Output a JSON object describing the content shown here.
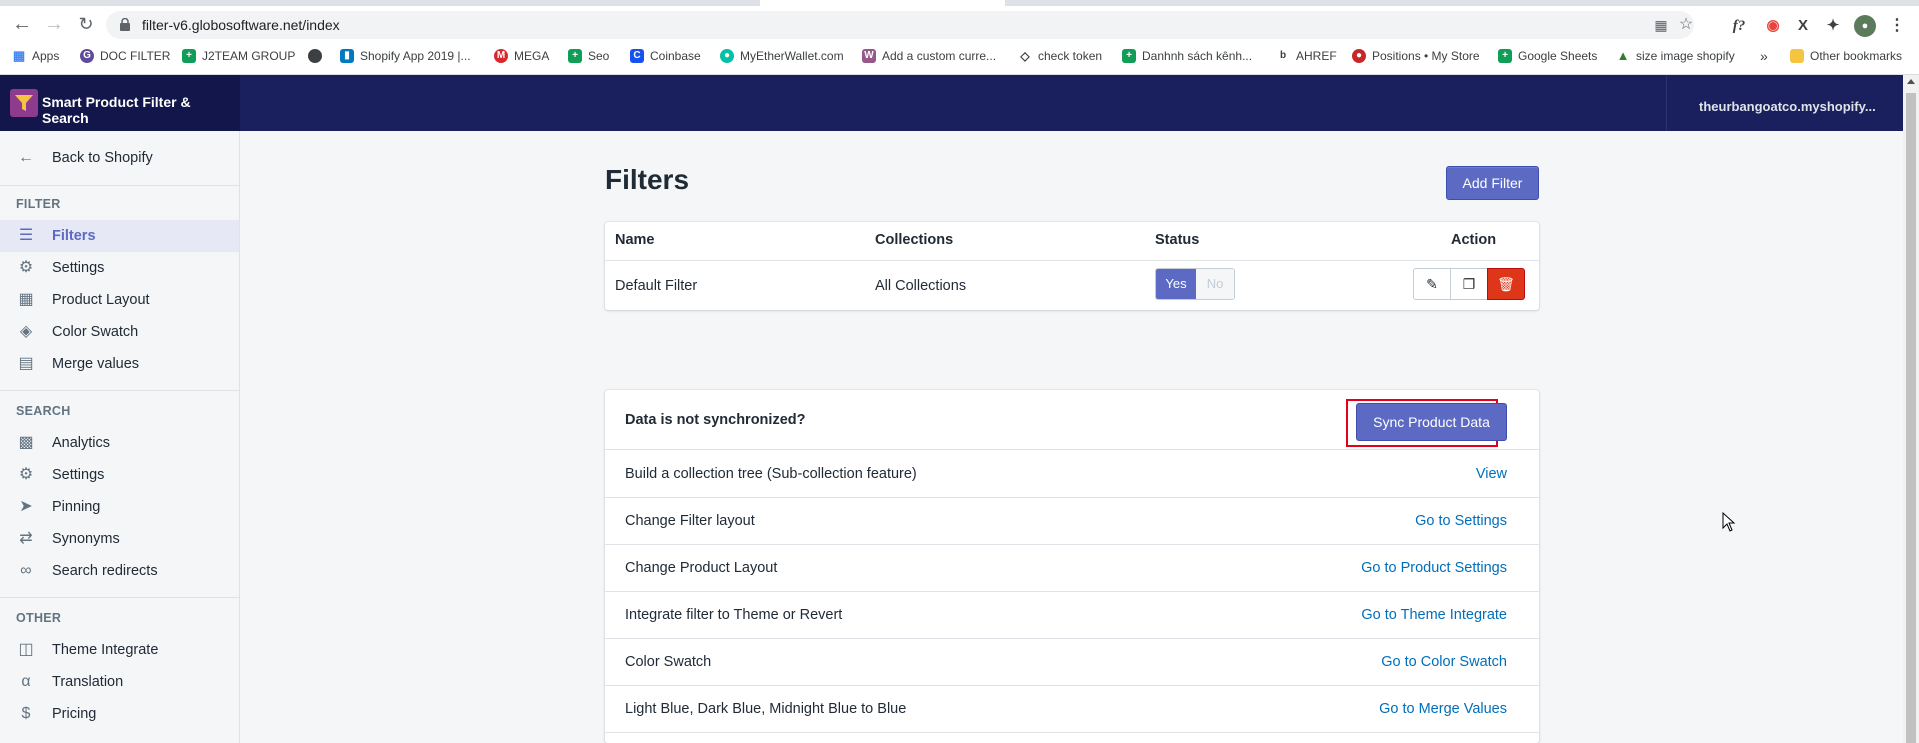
{
  "browser": {
    "url": "filter-v6.globosoftware.net/index",
    "bookmarks": [
      {
        "label": "Apps",
        "icon": "apps-grid-icon",
        "color": "#4285f4"
      },
      {
        "label": "DOC FILTER",
        "icon": "g-circle-icon",
        "color": "#5f4b9b"
      },
      {
        "label": "J2TEAM GROUP",
        "icon": "sheets-icon",
        "color": "#0f9d58"
      },
      {
        "label": "",
        "icon": "globe-icon",
        "color": "#3c4043"
      },
      {
        "label": "Shopify App 2019 |...",
        "icon": "trello-icon",
        "color": "#0079bf"
      },
      {
        "label": "MEGA",
        "icon": "mega-icon",
        "color": "#d9272e"
      },
      {
        "label": "Seo",
        "icon": "sheets-icon",
        "color": "#0f9d58"
      },
      {
        "label": "Coinbase",
        "icon": "coinbase-icon",
        "color": "#1652f0"
      },
      {
        "label": "MyEtherWallet.com",
        "icon": "mew-icon",
        "color": "#05c0a5"
      },
      {
        "label": "Add a custom curre...",
        "icon": "woo-icon",
        "color": "#96588a"
      },
      {
        "label": "check token",
        "icon": "ethereum-icon",
        "color": "#3c4043"
      },
      {
        "label": "Danhnh sách kênh...",
        "icon": "sheets-icon",
        "color": "#0f9d58"
      },
      {
        "label": "AHREF",
        "icon": "ahrefs-icon",
        "color": "#3c4043"
      },
      {
        "label": "Positions • My Store",
        "icon": "positions-icon",
        "color": "#c62828"
      },
      {
        "label": "Google Sheets",
        "icon": "sheets-icon",
        "color": "#0f9d58"
      },
      {
        "label": "size image shopify",
        "icon": "shopify-icon",
        "color": "#2e7d32"
      }
    ],
    "overflow": "»",
    "other_bookmarks": "Other bookmarks"
  },
  "app": {
    "title": "Smart Product Filter & Search",
    "store": "theurbangoatco.myshopify..."
  },
  "sidebar": {
    "back": "Back to Shopify",
    "sections": {
      "filter": "FILTER",
      "search": "SEARCH",
      "other": "OTHER"
    },
    "filter_items": [
      "Filters",
      "Settings",
      "Product Layout",
      "Color Swatch",
      "Merge values"
    ],
    "search_items": [
      "Analytics",
      "Settings",
      "Pinning",
      "Synonyms",
      "Search redirects"
    ],
    "other_items": [
      "Theme Integrate",
      "Translation",
      "Pricing"
    ]
  },
  "main": {
    "title": "Filters",
    "add_filter": "Add Filter",
    "table": {
      "headers": [
        "Name",
        "Collections",
        "Status",
        "Action"
      ],
      "rows": [
        {
          "name": "Default Filter",
          "collections": "All Collections",
          "status_yes": "Yes",
          "status_no": "No"
        }
      ]
    },
    "sync": {
      "question": "Data is not synchronized?",
      "button": "Sync Product Data"
    },
    "links": [
      {
        "label": "Build a collection tree (Sub-collection feature)",
        "link": "View"
      },
      {
        "label": "Change Filter layout",
        "link": "Go to Settings"
      },
      {
        "label": "Change Product Layout",
        "link": "Go to Product Settings"
      },
      {
        "label": "Integrate filter to Theme or Revert",
        "link": "Go to Theme Integrate"
      },
      {
        "label": "Color Swatch",
        "link": "Go to Color Swatch"
      },
      {
        "label": "Light Blue, Dark Blue, Midnight Blue to Blue",
        "link": "Go to Merge Values"
      }
    ]
  },
  "colors": {
    "primary": "#5c6ac4",
    "header": "#1a1f5e",
    "danger": "#de3618",
    "link": "#006fbb",
    "highlight": "#e3001b"
  }
}
